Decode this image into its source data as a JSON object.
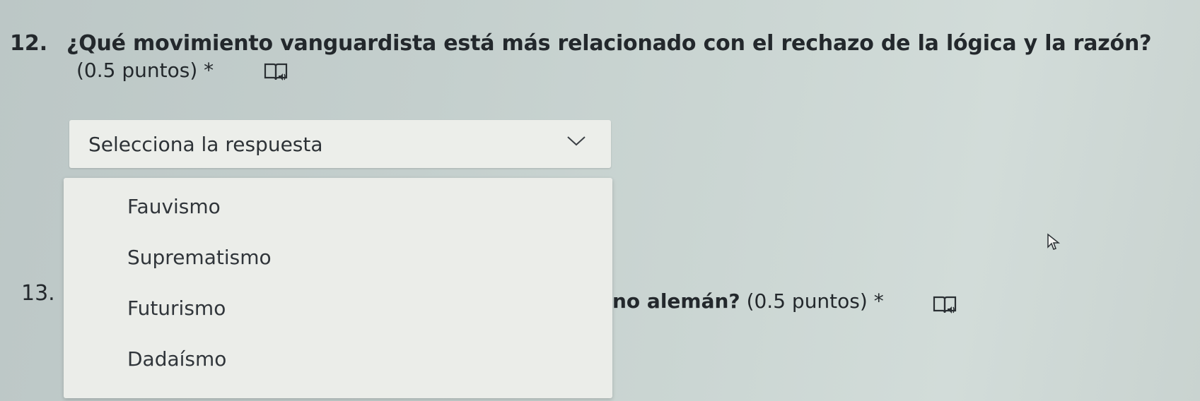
{
  "question12": {
    "number": "12.",
    "text": "¿Qué movimiento vanguardista está más relacionado con el rechazo de la lógica y la razón?",
    "points": "(0.5 puntos) *",
    "reader_icon": "immersive-reader-icon"
  },
  "dropdown": {
    "placeholder": "Selecciona la respuesta",
    "expanded": true,
    "options": [
      "Fauvismo",
      "Suprematismo",
      "Futurismo",
      "Dadaísmo"
    ]
  },
  "question13": {
    "number": "13.",
    "text_visible": "no alemán?",
    "points": "(0.5 puntos) *",
    "reader_icon": "immersive-reader-icon"
  },
  "colors": {
    "background": "#c4cfcd",
    "panel": "#ebede9",
    "text": "#23282c"
  }
}
